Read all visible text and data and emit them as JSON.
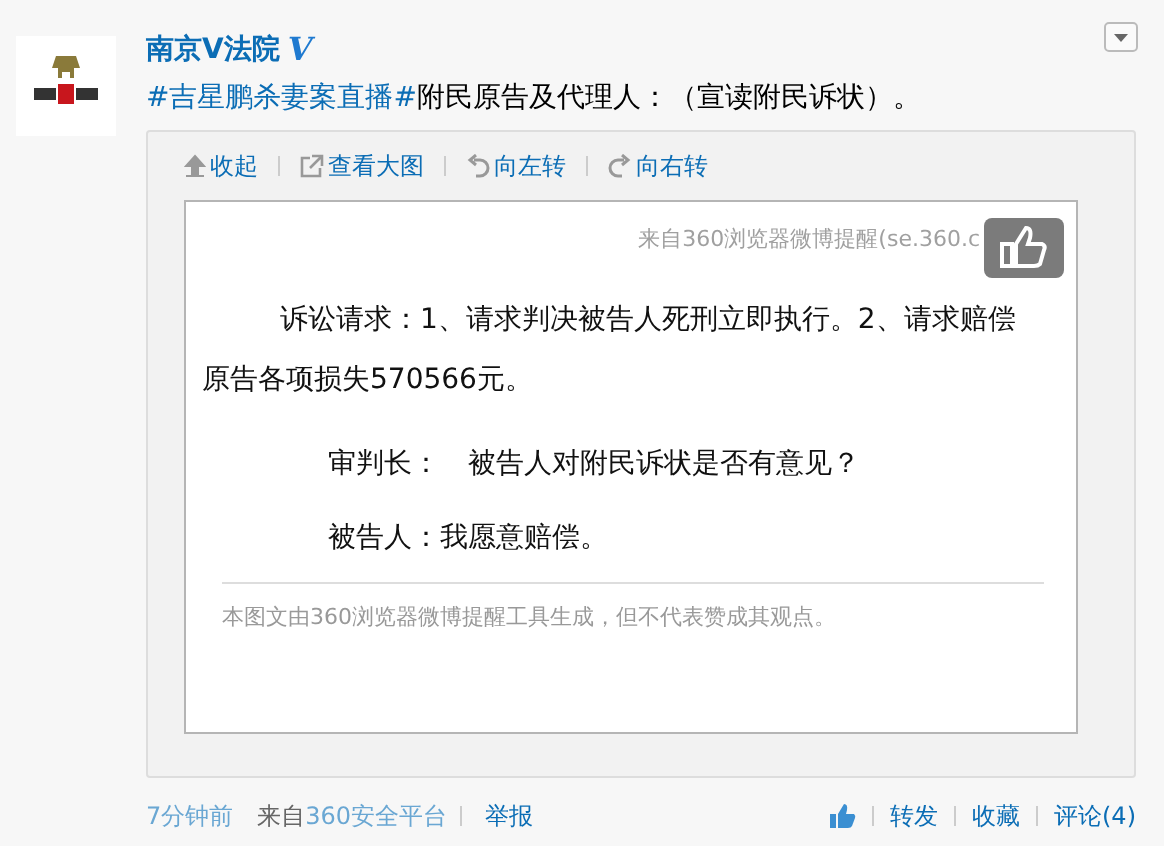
{
  "post": {
    "author": "南京V法院",
    "verified_mark": "V",
    "topic": "#吉星鹏杀妻案直播#",
    "text": "附民原告及代理人：（宣读附民诉状）。"
  },
  "media": {
    "toolbar": [
      {
        "label": "收起",
        "kind": "up"
      },
      {
        "label": "查看大图",
        "kind": "external"
      },
      {
        "label": "向左转",
        "kind": "left"
      },
      {
        "label": "向右转",
        "kind": "right"
      }
    ],
    "image": {
      "source": "来自360浏览器微博提醒(se.360.c",
      "paragraphs": [
        {
          "kind": "indent",
          "text": "诉讼请求：1、请求判决被告人死刑立即执行。2、请求赔偿原告各项损失570566元。"
        },
        {
          "kind": "speech",
          "text": "审判长：　被告人对附民诉状是否有意见？"
        },
        {
          "kind": "speech",
          "text": "被告人：我愿意赔偿。"
        }
      ],
      "disclaimer": "本图文由360浏览器微博提醒工具生成，但不代表赞成其观点。"
    }
  },
  "footer": {
    "time": "7分钟前",
    "via_label": "来自",
    "via": "360安全平台",
    "report": "举报",
    "actions": [
      "转发",
      "收藏",
      "评论(4)"
    ]
  }
}
